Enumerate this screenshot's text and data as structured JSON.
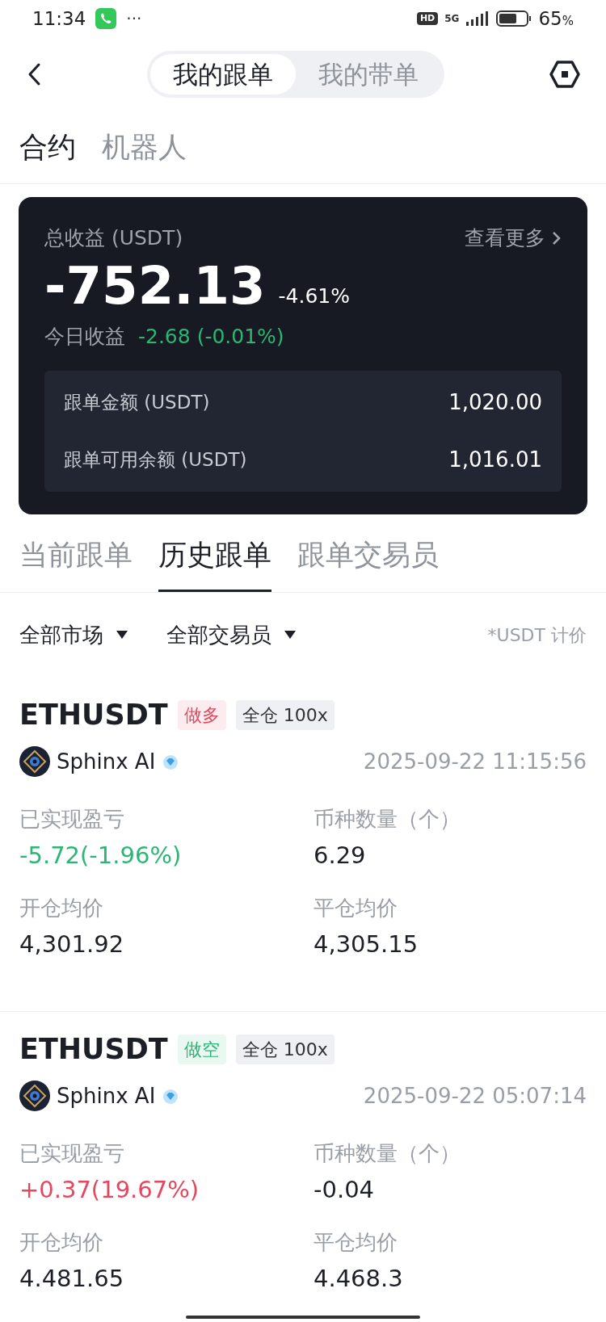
{
  "status_bar": {
    "time": "11:34",
    "more": "···",
    "hd": "HD",
    "network": "5G",
    "battery_percent": "65",
    "battery_unit": "%"
  },
  "header": {
    "segments": [
      {
        "label": "我的跟单",
        "selected": true
      },
      {
        "label": "我的带单",
        "selected": false
      }
    ]
  },
  "sub_tabs": [
    {
      "label": "合约",
      "selected": true
    },
    {
      "label": "机器人",
      "selected": false
    }
  ],
  "summary": {
    "title": "总收益 (USDT)",
    "more": "查看更多",
    "total": "-752.13",
    "total_percent": "-4.61%",
    "today_label": "今日收益",
    "today_value": "-2.68 (-0.01%)",
    "rows": [
      {
        "label": "跟单金额 (USDT)",
        "value": "1,020.00"
      },
      {
        "label": "跟单可用余额 (USDT)",
        "value": "1,016.01"
      }
    ]
  },
  "tabs": [
    {
      "label": "当前跟单",
      "selected": false
    },
    {
      "label": "历史跟单",
      "selected": true
    },
    {
      "label": "跟单交易员",
      "selected": false
    }
  ],
  "filters": {
    "dropdowns": [
      "全部市场",
      "全部交易员"
    ],
    "note": "*USDT 计价"
  },
  "trades": [
    {
      "symbol": "ETHUSDT",
      "side": {
        "label": "做多",
        "color": "#e5475f"
      },
      "margin": "全仓 100x",
      "trader": "Sphinx AI",
      "time": "2025-09-22 11:15:56",
      "pnl_label": "已实现盈亏",
      "pnl": {
        "text": "-5.72(-1.96%)",
        "color": "#2bb673"
      },
      "qty_label": "币种数量（个）",
      "qty": "6.29",
      "open_label": "开仓均价",
      "open": "4,301.92",
      "close_label": "平仓均价",
      "close": "4,305.15"
    },
    {
      "symbol": "ETHUSDT",
      "side": {
        "label": "做空",
        "color": "#2bb673"
      },
      "margin": "全仓 100x",
      "trader": "Sphinx AI",
      "time": "2025-09-22 05:07:14",
      "pnl_label": "已实现盈亏",
      "pnl": {
        "text": "+0.37(19.67%)",
        "color": "#e5475f"
      },
      "qty_label": "币种数量（个）",
      "qty": "-0.04",
      "open_label": "开仓均价",
      "open": "4.481.65",
      "close_label": "平仓均价",
      "close": "4.468.3"
    }
  ]
}
